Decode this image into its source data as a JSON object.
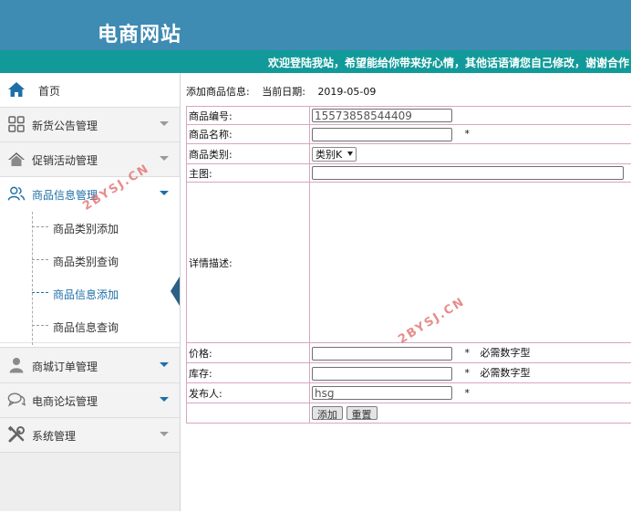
{
  "header": {
    "title": "电商网站",
    "marquee": "欢迎登陆我站，希望能给你带来好心情，其他话语请您自己修改，谢谢合作！"
  },
  "sidebar": {
    "items": [
      {
        "label": "首页",
        "icon": "home-icon"
      },
      {
        "label": "新货公告管理",
        "icon": "grid-icon"
      },
      {
        "label": "促销活动管理",
        "icon": "home-outline-icon"
      },
      {
        "label": "商品信息管理",
        "icon": "users-icon"
      },
      {
        "label": "商城订单管理",
        "icon": "user-icon"
      },
      {
        "label": "电商论坛管理",
        "icon": "chat-icon"
      },
      {
        "label": "系统管理",
        "icon": "tools-icon"
      }
    ],
    "subitems": [
      {
        "label": "商品类别添加"
      },
      {
        "label": "商品类别查询"
      },
      {
        "label": "商品信息添加"
      },
      {
        "label": "商品信息查询"
      }
    ]
  },
  "content": {
    "heading": "添加商品信息:",
    "date_label": "当前日期:",
    "date": "2019-05-09"
  },
  "form": {
    "code_label": "商品编号:",
    "code_value": "15573858544409",
    "name_label": "商品名称:",
    "category_label": "商品类别:",
    "category_value": "类别K",
    "image_label": "主图:",
    "detail_label": "详情描述:",
    "price_label": "价格:",
    "stock_label": "库存:",
    "publisher_label": "发布人:",
    "publisher_value": "hsg",
    "required_mark": "*",
    "numeric_hint": "必需数字型",
    "add_label": "添加",
    "reset_label": "重置"
  },
  "watermark": "2BYSJ.CN",
  "colors": {
    "header": "#3e8bb3",
    "marquee_bar": "#119a99",
    "accent": "#1e6fa8",
    "table_border": "#d6a6c2"
  }
}
